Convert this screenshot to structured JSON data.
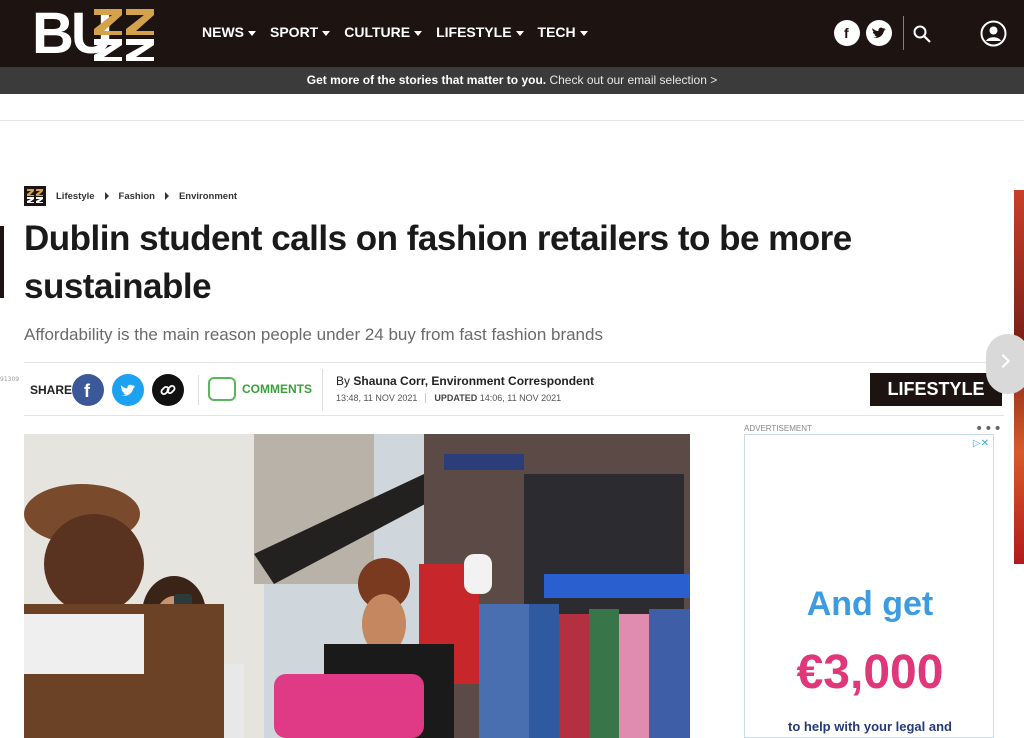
{
  "header": {
    "logo_text": "BUZZ",
    "nav": [
      {
        "label": "NEWS"
      },
      {
        "label": "SPORT"
      },
      {
        "label": "CULTURE"
      },
      {
        "label": "LIFESTYLE"
      },
      {
        "label": "TECH"
      }
    ],
    "icons": [
      "facebook-icon",
      "twitter-icon",
      "search-icon",
      "account-icon"
    ]
  },
  "promo": {
    "bold": "Get more of the stories that matter to you.",
    "link": "Check out our email selection >"
  },
  "breadcrumb": [
    "Lifestyle",
    "Fashion",
    "Environment"
  ],
  "article": {
    "headline": "Dublin student calls on fashion retailers to be more sustainable",
    "standfirst": "Affordability is the main reason people under 24 buy from fast fashion brands",
    "share_label": "SHARE",
    "comments_label": "COMMENTS",
    "by": "By",
    "author": "Shauna Corr, Environment Correspondent",
    "published": "13:48, 11 NOV 2021",
    "updated_label": "UPDATED",
    "updated": "14:06, 11 NOV 2021",
    "category": "LIFESTYLE",
    "side_id": "91309"
  },
  "ad": {
    "label": "ADVERTISEMENT",
    "line1": "And get",
    "line2": "€3,000",
    "line3": "to help with your legal and"
  },
  "colors": {
    "brand_dark": "#1d1412",
    "brand_gold": "#d4a24a",
    "comments_green": "#3aa13a",
    "ad_blue": "#3d9ce0",
    "ad_pink": "#e0367a"
  }
}
